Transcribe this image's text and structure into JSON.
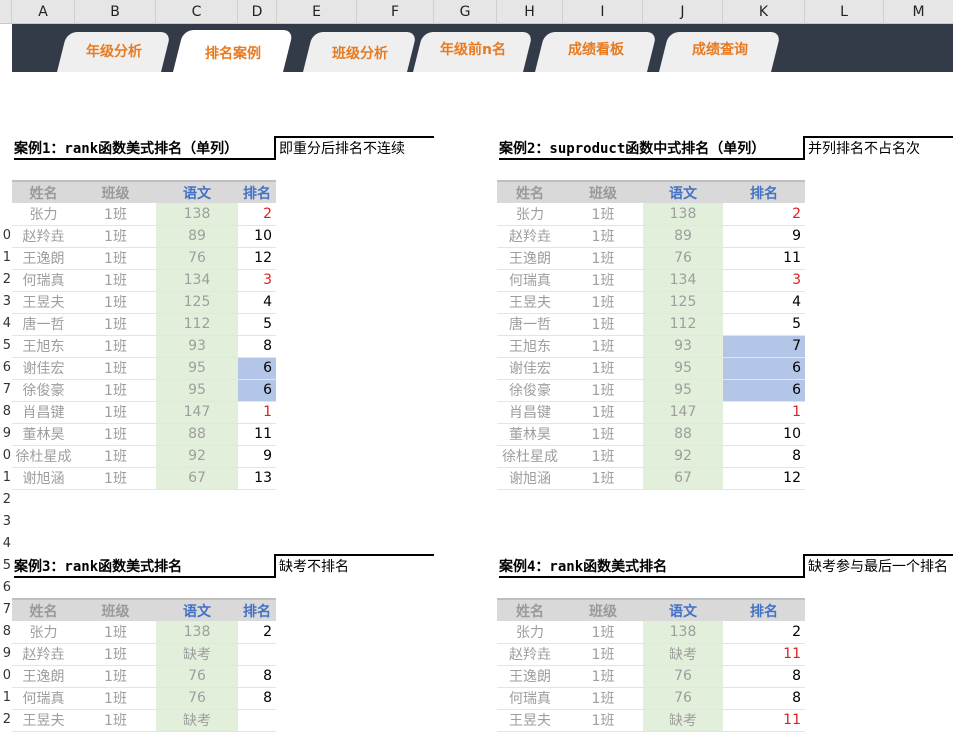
{
  "columns": [
    "A",
    "B",
    "C",
    "D",
    "E",
    "F",
    "G",
    "H",
    "I",
    "J",
    "K",
    "L",
    "M"
  ],
  "row_numbers": [
    "0",
    "1",
    "2",
    "3",
    "4",
    "5",
    "6",
    "7",
    "8",
    "9",
    "0",
    "1",
    "2",
    "3",
    "4",
    "5",
    "6",
    "7",
    "8",
    "9",
    "0",
    "1",
    "2"
  ],
  "tabs": [
    {
      "label": "年级分析",
      "active": false
    },
    {
      "label": "排名案例",
      "active": true
    },
    {
      "label": "班级分析",
      "active": false
    },
    {
      "label": "年级前n名",
      "active": false
    },
    {
      "label": "成绩看板",
      "active": false
    },
    {
      "label": "成绩查询",
      "active": false
    }
  ],
  "headers": [
    "姓名",
    "班级",
    "语文",
    "排名"
  ],
  "colors": {
    "banner": "#323b47",
    "tab_text": "#e87a1f",
    "score_fill": "#e2efda",
    "highlight_fill": "#b4c6e7",
    "rank_red": "#e01e1e",
    "header_blue": "#4472c4"
  },
  "cases": [
    {
      "title": "案例1：rank函数美式排名（单列）",
      "note": "即重分后排名不连续",
      "rows": [
        {
          "name": "张力",
          "cls": "1班",
          "score": "138",
          "rank": "2",
          "red": true,
          "hl": false
        },
        {
          "name": "赵羚垚",
          "cls": "1班",
          "score": "89",
          "rank": "10",
          "red": false,
          "hl": false
        },
        {
          "name": "王逸朗",
          "cls": "1班",
          "score": "76",
          "rank": "12",
          "red": false,
          "hl": false
        },
        {
          "name": "何瑞真",
          "cls": "1班",
          "score": "134",
          "rank": "3",
          "red": true,
          "hl": false
        },
        {
          "name": "王昱夫",
          "cls": "1班",
          "score": "125",
          "rank": "4",
          "red": false,
          "hl": false
        },
        {
          "name": "唐一哲",
          "cls": "1班",
          "score": "112",
          "rank": "5",
          "red": false,
          "hl": false
        },
        {
          "name": "王旭东",
          "cls": "1班",
          "score": "93",
          "rank": "8",
          "red": false,
          "hl": false
        },
        {
          "name": "谢佳宏",
          "cls": "1班",
          "score": "95",
          "rank": "6",
          "red": false,
          "hl": true
        },
        {
          "name": "徐俊豪",
          "cls": "1班",
          "score": "95",
          "rank": "6",
          "red": false,
          "hl": true
        },
        {
          "name": "肖昌键",
          "cls": "1班",
          "score": "147",
          "rank": "1",
          "red": true,
          "hl": false
        },
        {
          "name": "董林昊",
          "cls": "1班",
          "score": "88",
          "rank": "11",
          "red": false,
          "hl": false
        },
        {
          "name": "徐杜星成",
          "cls": "1班",
          "score": "92",
          "rank": "9",
          "red": false,
          "hl": false
        },
        {
          "name": "谢旭涵",
          "cls": "1班",
          "score": "67",
          "rank": "13",
          "red": false,
          "hl": false
        }
      ]
    },
    {
      "title": "案例2：suproduct函数中式排名（单列）",
      "note": "并列排名不占名次",
      "rows": [
        {
          "name": "张力",
          "cls": "1班",
          "score": "138",
          "rank": "2",
          "red": true,
          "hl": false
        },
        {
          "name": "赵羚垚",
          "cls": "1班",
          "score": "89",
          "rank": "9",
          "red": false,
          "hl": false
        },
        {
          "name": "王逸朗",
          "cls": "1班",
          "score": "76",
          "rank": "11",
          "red": false,
          "hl": false
        },
        {
          "name": "何瑞真",
          "cls": "1班",
          "score": "134",
          "rank": "3",
          "red": true,
          "hl": false
        },
        {
          "name": "王昱夫",
          "cls": "1班",
          "score": "125",
          "rank": "4",
          "red": false,
          "hl": false
        },
        {
          "name": "唐一哲",
          "cls": "1班",
          "score": "112",
          "rank": "5",
          "red": false,
          "hl": false
        },
        {
          "name": "王旭东",
          "cls": "1班",
          "score": "93",
          "rank": "7",
          "red": false,
          "hl": true
        },
        {
          "name": "谢佳宏",
          "cls": "1班",
          "score": "95",
          "rank": "6",
          "red": false,
          "hl": true
        },
        {
          "name": "徐俊豪",
          "cls": "1班",
          "score": "95",
          "rank": "6",
          "red": false,
          "hl": true
        },
        {
          "name": "肖昌键",
          "cls": "1班",
          "score": "147",
          "rank": "1",
          "red": true,
          "hl": false
        },
        {
          "name": "董林昊",
          "cls": "1班",
          "score": "88",
          "rank": "10",
          "red": false,
          "hl": false
        },
        {
          "name": "徐杜星成",
          "cls": "1班",
          "score": "92",
          "rank": "8",
          "red": false,
          "hl": false
        },
        {
          "name": "谢旭涵",
          "cls": "1班",
          "score": "67",
          "rank": "12",
          "red": false,
          "hl": false
        }
      ]
    },
    {
      "title": "案例3：rank函数美式排名",
      "note": "缺考不排名",
      "rows": [
        {
          "name": "张力",
          "cls": "1班",
          "score": "138",
          "rank": "2",
          "red": false,
          "hl": false
        },
        {
          "name": "赵羚垚",
          "cls": "1班",
          "score": "缺考",
          "rank": "",
          "red": false,
          "hl": false
        },
        {
          "name": "王逸朗",
          "cls": "1班",
          "score": "76",
          "rank": "8",
          "red": false,
          "hl": false
        },
        {
          "name": "何瑞真",
          "cls": "1班",
          "score": "76",
          "rank": "8",
          "red": false,
          "hl": false
        },
        {
          "name": "王昱夫",
          "cls": "1班",
          "score": "缺考",
          "rank": "",
          "red": false,
          "hl": false
        }
      ]
    },
    {
      "title": "案例4：rank函数美式排名",
      "note": "缺考参与最后一个排名",
      "rows": [
        {
          "name": "张力",
          "cls": "1班",
          "score": "138",
          "rank": "2",
          "red": false,
          "hl": false
        },
        {
          "name": "赵羚垚",
          "cls": "1班",
          "score": "缺考",
          "rank": "11",
          "red": true,
          "hl": false
        },
        {
          "name": "王逸朗",
          "cls": "1班",
          "score": "76",
          "rank": "8",
          "red": false,
          "hl": false
        },
        {
          "name": "何瑞真",
          "cls": "1班",
          "score": "76",
          "rank": "8",
          "red": false,
          "hl": false
        },
        {
          "name": "王昱夫",
          "cls": "1班",
          "score": "缺考",
          "rank": "11",
          "red": true,
          "hl": false
        }
      ]
    }
  ]
}
